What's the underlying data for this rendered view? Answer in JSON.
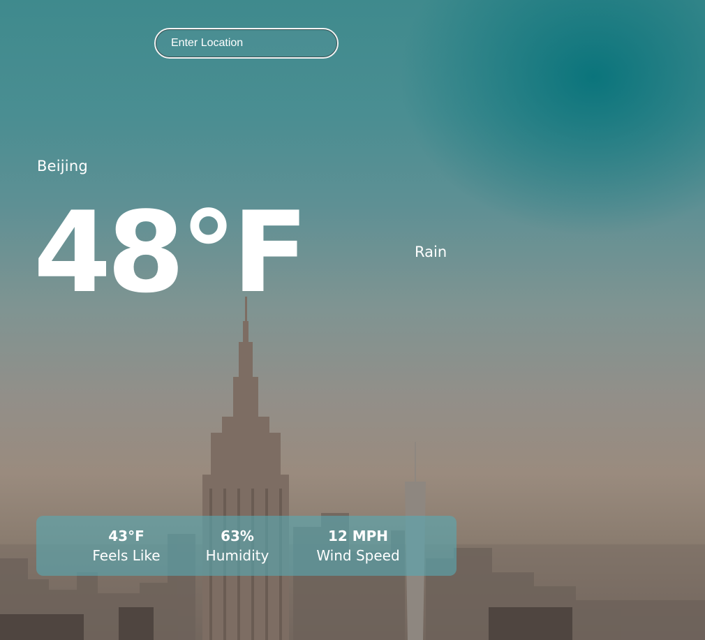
{
  "search": {
    "placeholder": "Enter Location"
  },
  "location": {
    "name": "Beijing"
  },
  "current": {
    "temperature": "48°F",
    "description": "Rain"
  },
  "stats": {
    "feels_like": {
      "value": "43°F",
      "label": "Feels Like"
    },
    "humidity": {
      "value": "63%",
      "label": "Humidity"
    },
    "wind_speed": {
      "value": "12 MPH",
      "label": "Wind Speed"
    }
  },
  "colors": {
    "text": "#ffffff",
    "panel": "#58a8b2",
    "sky_top": "#007078",
    "sky_mid": "#5e9094",
    "haze": "#9a8b7e"
  }
}
